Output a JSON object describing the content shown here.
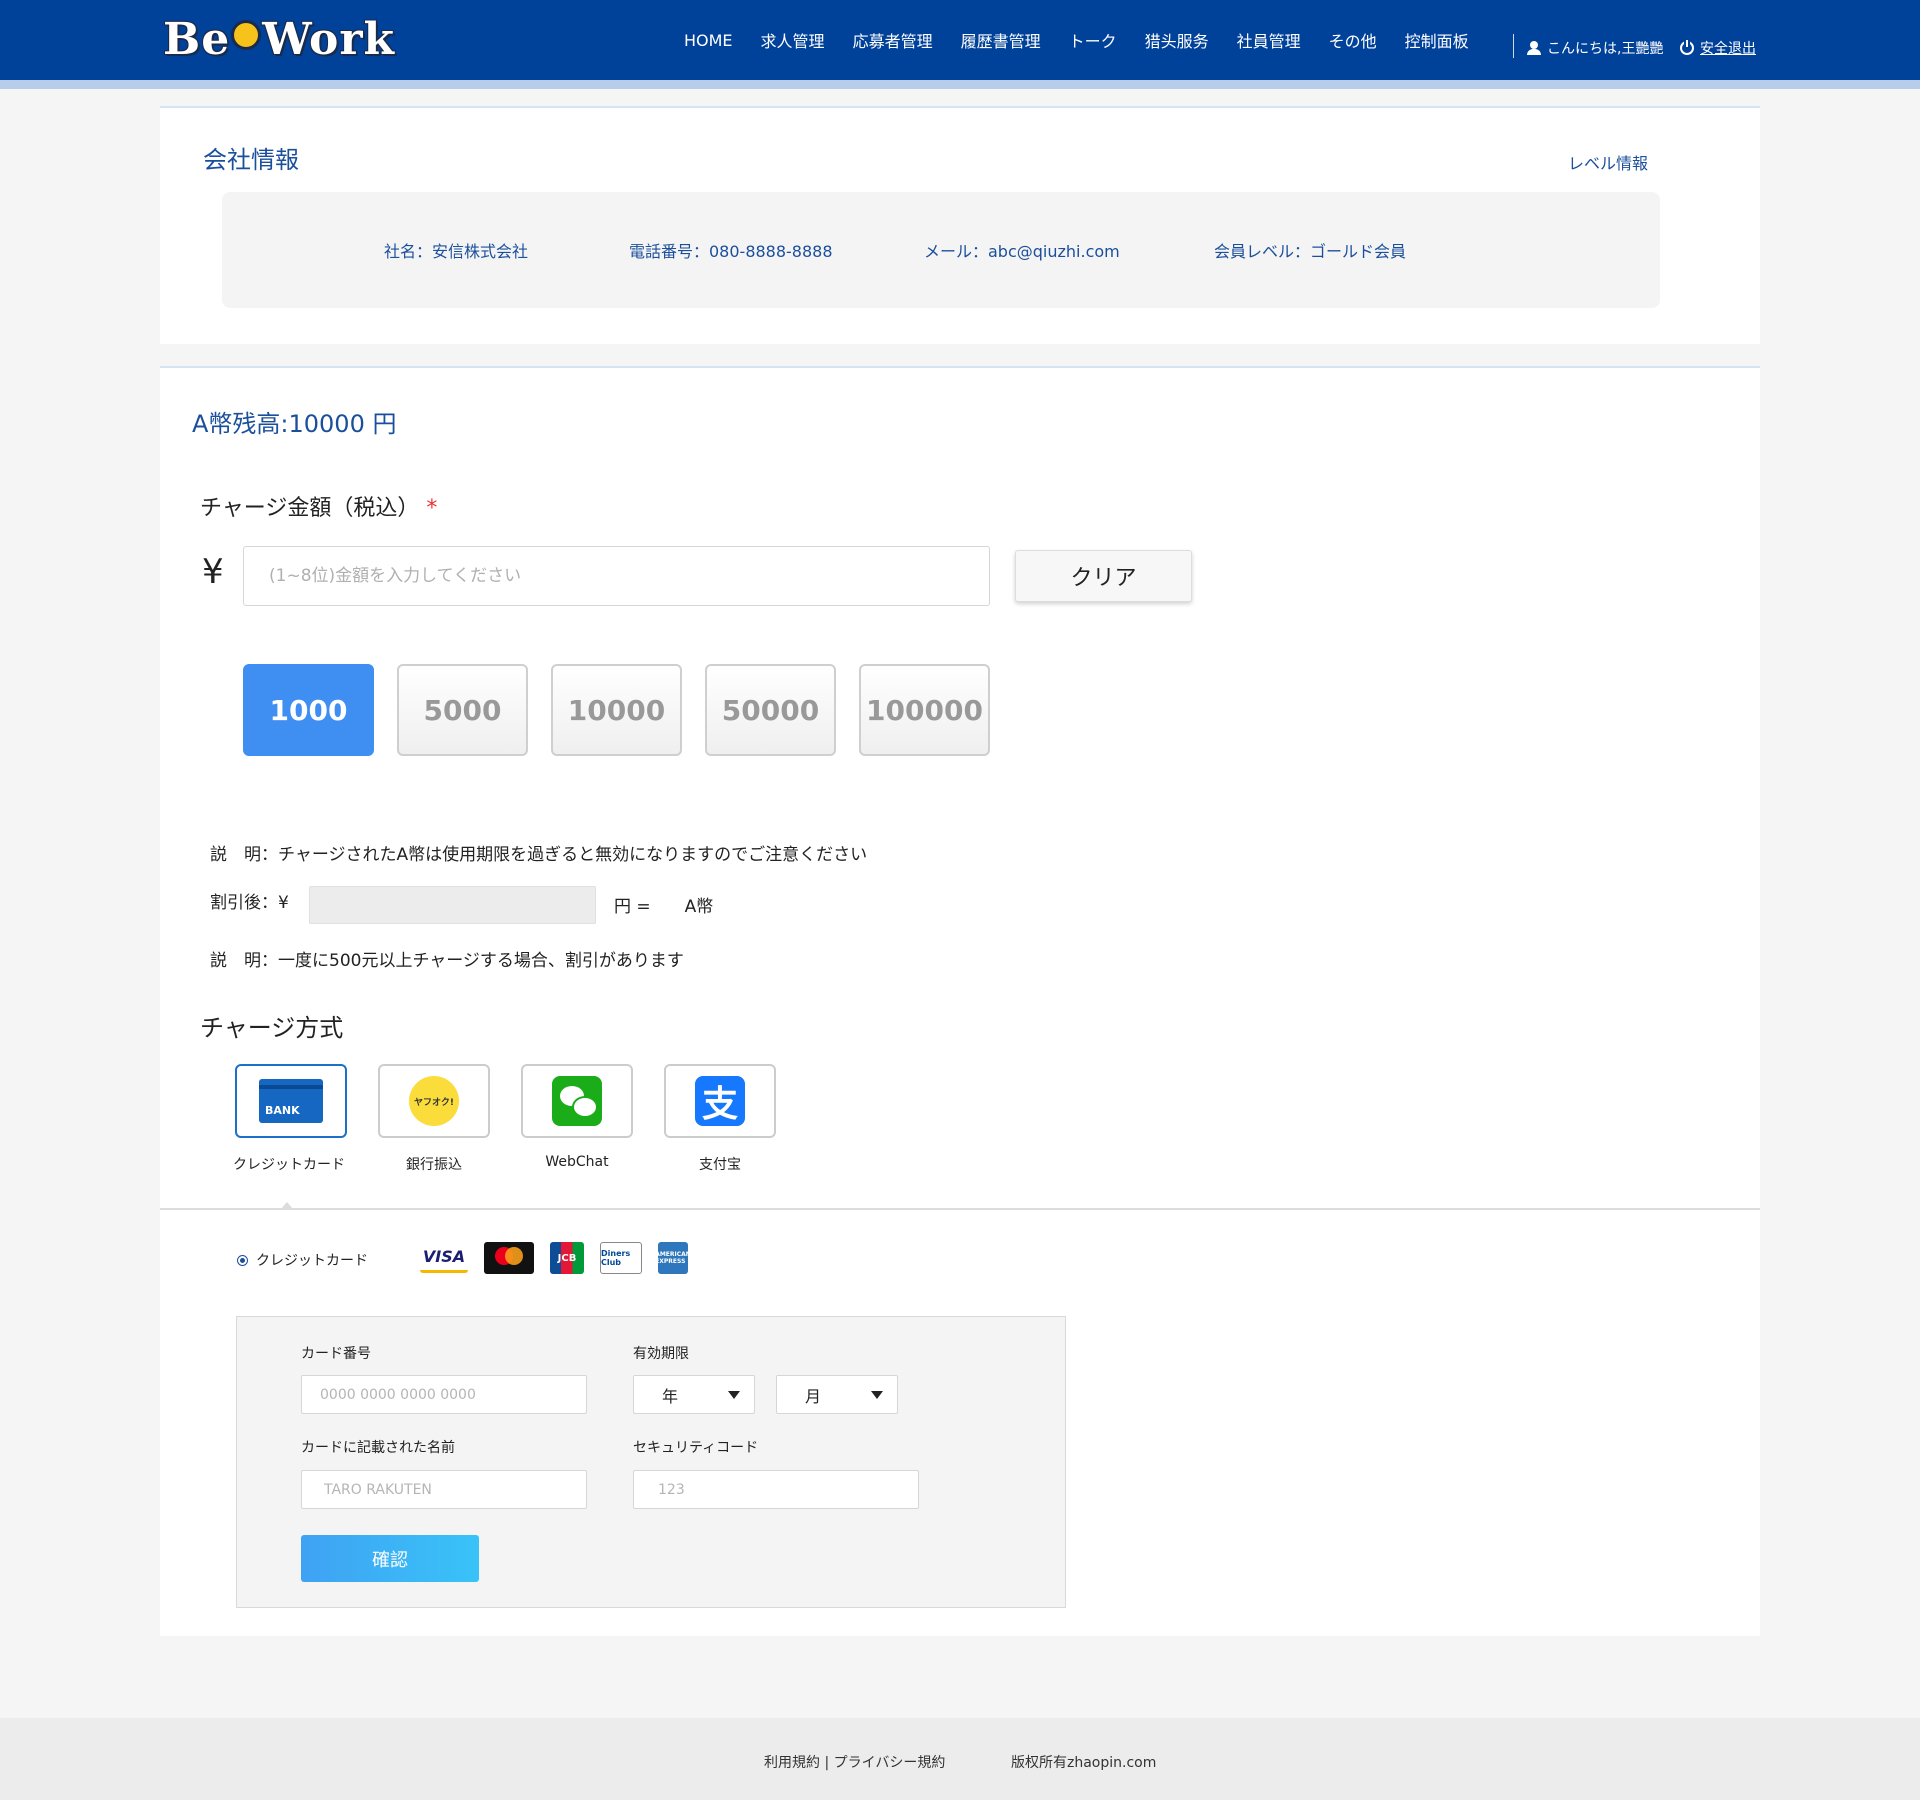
{
  "brand": {
    "logo_text_left": "Be",
    "logo_text_right": "Work"
  },
  "nav": {
    "items": [
      "HOME",
      "求人管理",
      "応募者管理",
      "履歴書管理",
      "トーク",
      "猎头服务",
      "社員管理",
      "その他",
      "控制面板"
    ],
    "greeting": "こんにちは,王艷艷",
    "logout": "安全退出"
  },
  "company": {
    "title": "会社情報",
    "level_link": "レベル情報",
    "name": "社名：安信株式会社",
    "phone": "電話番号：080-8888-8888",
    "email": "メール：abc@qiuzhi.com",
    "level": "会員レベル：ゴールド会員"
  },
  "charge": {
    "balance": "A幣残高:10000 円",
    "title": "チャージ金額（税込）",
    "required_mark": "*",
    "currency_symbol": "¥",
    "amount_placeholder": "(1~8位)金額を入力してください",
    "clear_label": "クリア",
    "preset_amounts": [
      "1000",
      "5000",
      "10000",
      "50000",
      "100000"
    ],
    "selected_amount": "1000",
    "note1": "説　明：チャージされたA幣は使用期限を過ぎると無効になりますのでご注意ください",
    "discount_label": "割引後：¥",
    "discount_suffix": "円 =　　A幣",
    "note2": "説　明：一度に500元以上チャージする場合、割引があります"
  },
  "methods": {
    "title": "チャージ方式",
    "items": [
      {
        "label": "クレジットカード",
        "icon": "bank-card-icon",
        "badge": "BANK"
      },
      {
        "label": "銀行振込",
        "icon": "yahoo-auction-icon",
        "badge": "ヤフオク!"
      },
      {
        "label": "WebChat",
        "icon": "wechat-icon"
      },
      {
        "label": "支付宝",
        "icon": "alipay-icon",
        "badge": "支"
      }
    ],
    "selected": "クレジットカード"
  },
  "payment": {
    "radio_label": "クレジットカード",
    "cards": {
      "visa": "VISA",
      "jcb": "JCB",
      "diners": "Diners Club",
      "amex": "AMERICAN EXPRESS"
    },
    "card_number_label": "カード番号",
    "card_number_placeholder": "0000 0000 0000 0000",
    "expiry_label": "有効期限",
    "year_label": "年",
    "month_label": "月",
    "name_label": "カードに記載された名前",
    "name_placeholder": "TARO RAKUTEN",
    "cvc_label": "セキュリティコード",
    "cvc_placeholder": "123",
    "confirm_label": "確認"
  },
  "footer": {
    "links": "利用規約 | プライバシー規約",
    "copyright": "版权所有zhaopin.com"
  },
  "colors": {
    "header": "#00419a",
    "accent": "#1b4f9c",
    "selected_amount": "#3f8ff3"
  }
}
